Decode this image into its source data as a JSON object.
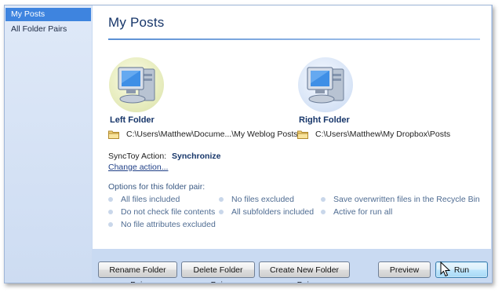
{
  "sidebar": {
    "items": [
      {
        "label": "My Posts",
        "selected": true
      },
      {
        "label": "All Folder Pairs",
        "selected": false
      }
    ]
  },
  "main": {
    "title": "My Posts",
    "left_folder": {
      "heading": "Left Folder",
      "path": "C:\\Users\\Matthew\\Docume...\\My Weblog Posts",
      "icon": "computer-icon"
    },
    "right_folder": {
      "heading": "Right Folder",
      "path": "C:\\Users\\Matthew\\My Dropbox\\Posts",
      "icon": "computer-icon"
    },
    "action_label": "SyncToy Action:",
    "action_value": "Synchronize",
    "change_action": "Change action...",
    "options_label": "Options for this folder pair:",
    "options": [
      "All files included",
      "Do not check file contents",
      "No file attributes excluded",
      "No files excluded",
      "All subfolders included",
      "Save overwritten files in the Recycle Bin",
      "Active for run all"
    ]
  },
  "buttons": {
    "rename": "Rename Folder Pair",
    "delete": "Delete Folder Pair",
    "create": "Create New Folder Pair",
    "preview": "Preview",
    "run": "Run"
  },
  "colors": {
    "selection": "#3e84df",
    "window_frame": "#c9daf2",
    "title_text": "#17366a",
    "link": "#1f3f86"
  }
}
